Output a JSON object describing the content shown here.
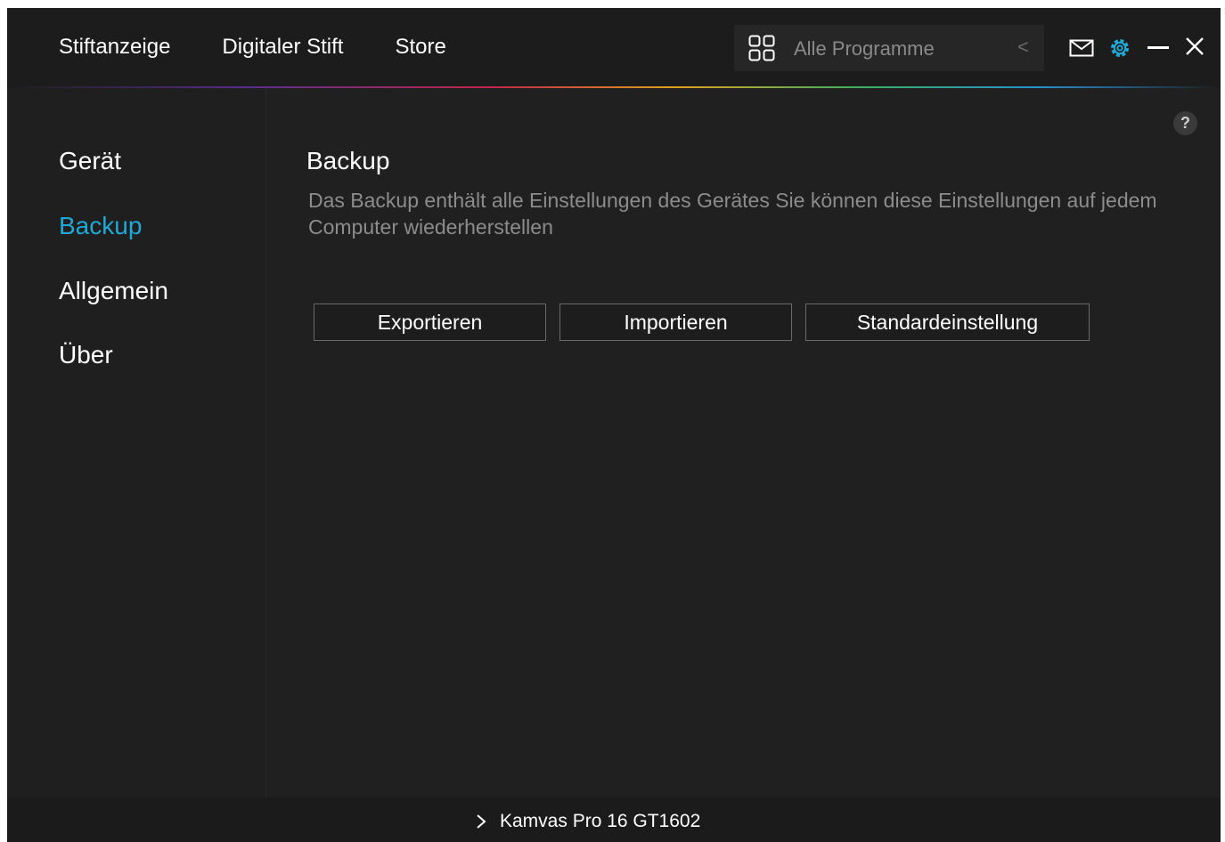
{
  "topnav": {
    "items": [
      "Stiftanzeige",
      "Digitaler Stift",
      "Store"
    ]
  },
  "program_select": {
    "icon": "grid-icon",
    "label": "Alle Programme",
    "chevron": "<"
  },
  "window_controls": {
    "icons": [
      "mail-icon",
      "gear-icon",
      "minimize-icon",
      "close-icon"
    ],
    "accent": "#1fa9d6"
  },
  "sidebar": {
    "items": [
      "Gerät",
      "Backup",
      "Allgemein",
      "Über"
    ],
    "active_index": 1
  },
  "main": {
    "help_label": "?",
    "title": "Backup",
    "description": "Das Backup enthält alle Einstellungen des Gerätes Sie können diese Einstellungen auf jedem Computer wiederherstellen",
    "buttons": {
      "export": "Exportieren",
      "import": "Importieren",
      "default": "Standardeinstellung"
    }
  },
  "statusbar": {
    "device_label": "Kamvas Pro 16 GT1602"
  },
  "colors": {
    "background": "#202020",
    "accent": "#1fa9d6",
    "muted_text": "#8c8c8c"
  }
}
